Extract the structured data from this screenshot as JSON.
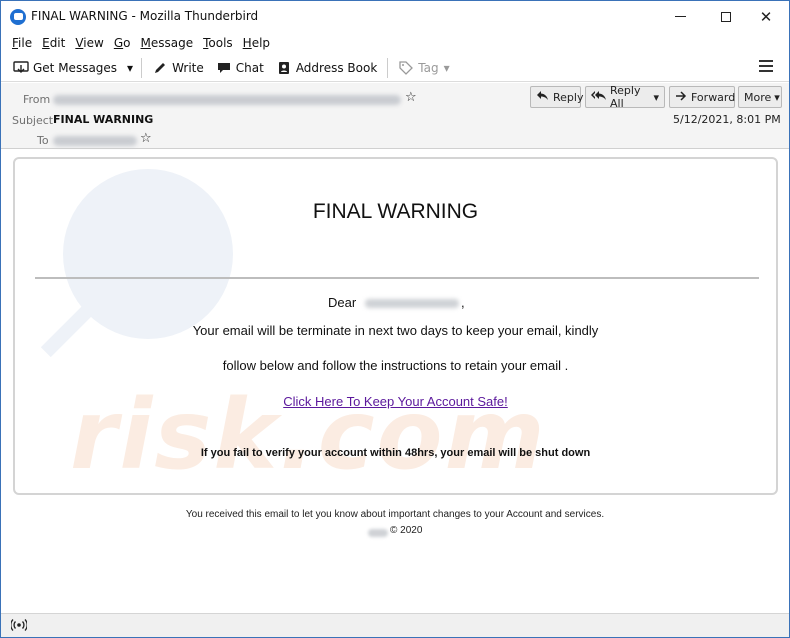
{
  "window": {
    "title": "FINAL WARNING - Mozilla Thunderbird",
    "controls": {
      "minimize": "",
      "maximize": "",
      "close": "✕"
    }
  },
  "menu": [
    {
      "underline": "F",
      "rest": "ile"
    },
    {
      "underline": "E",
      "rest": "dit"
    },
    {
      "underline": "V",
      "rest": "iew"
    },
    {
      "underline": "G",
      "rest": "o"
    },
    {
      "underline": "M",
      "rest": "essage"
    },
    {
      "underline": "T",
      "rest": "ools"
    },
    {
      "underline": "H",
      "rest": "elp"
    }
  ],
  "toolbar": {
    "get_messages": "Get Messages",
    "dropdown": "▾",
    "write": "Write",
    "chat": "Chat",
    "address_book": "Address Book",
    "tag": "Tag",
    "icons": {
      "get_messages": "download-icon",
      "write": "pencil-icon",
      "chat": "chat-bubble-icon",
      "address_book": "address-book-icon",
      "tag": "tag-icon",
      "menu": "hamburger-icon"
    }
  },
  "header": {
    "from_label": "From",
    "subject_label": "Subject",
    "subject": "FINAL WARNING",
    "to_label": "To",
    "date": "5/12/2021, 8:01 PM",
    "star": "☆",
    "buttons": {
      "reply": "Reply",
      "reply_all": "Reply All",
      "dropdown": "▾",
      "forward": "Forward",
      "more": "More"
    }
  },
  "email": {
    "title": "FINAL WARNING",
    "dear": "Dear",
    "comma": ",",
    "line1": "Your email will be terminate in next two days to keep your email, kindly",
    "line2": "follow below and follow the instructions to retain your email .",
    "link": "Click Here To Keep Your Account Safe!",
    "warning": "If you fail to verify your account within 48hrs, your email will be shut down",
    "footer": "You received this email to let you know about important changes to your Account and services.",
    "copyright": "© 2020"
  },
  "watermark": {
    "text": "risk.com"
  },
  "status": {
    "icon": "((•))"
  }
}
